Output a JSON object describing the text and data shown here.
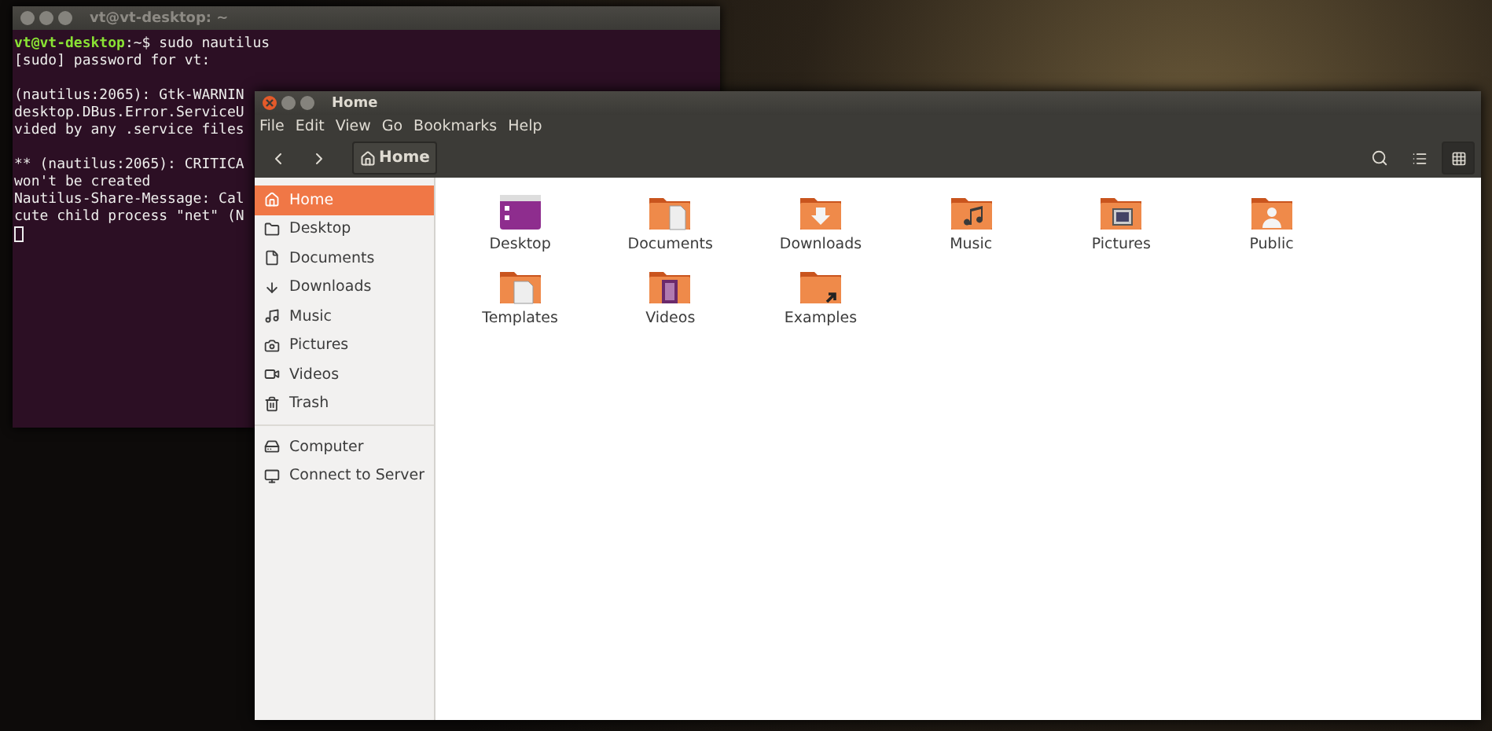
{
  "terminal": {
    "title": "vt@vt-desktop: ~",
    "prompt": {
      "user": "vt@vt-desktop",
      "rest": ":~$ sudo nautilus"
    },
    "blocks": [
      [
        "[sudo] password for vt:"
      ],
      [
        "(nautilus:2065): Gtk-WARNIN",
        "desktop.DBus.Error.ServiceU",
        "vided by any .service files"
      ],
      [
        "** (nautilus:2065): CRITICA",
        "won't be created",
        "Nautilus-Share-Message: Cal",
        "cute child process \"net\" (N"
      ]
    ]
  },
  "window": {
    "title": "Home"
  },
  "menu": [
    "File",
    "Edit",
    "View",
    "Go",
    "Bookmarks",
    "Help"
  ],
  "toolbar": {
    "path": "Home",
    "views": [
      {
        "kind": "list",
        "selected": false
      },
      {
        "kind": "grid",
        "selected": true
      }
    ]
  },
  "sidebar": {
    "sections": [
      {
        "items": [
          {
            "label": "Home",
            "kind": "home",
            "selected": true
          },
          {
            "label": "Desktop",
            "kind": "desktop",
            "selected": false
          },
          {
            "label": "Documents",
            "kind": "documents",
            "selected": false
          },
          {
            "label": "Downloads",
            "kind": "downloads",
            "selected": false
          },
          {
            "label": "Music",
            "kind": "music",
            "selected": false
          },
          {
            "label": "Pictures",
            "kind": "pictures",
            "selected": false
          },
          {
            "label": "Videos",
            "kind": "videos",
            "selected": false
          },
          {
            "label": "Trash",
            "kind": "trash",
            "selected": false
          }
        ]
      },
      {
        "items": [
          {
            "label": "Computer",
            "kind": "computer",
            "selected": false
          },
          {
            "label": "Connect to Server",
            "kind": "server",
            "selected": false
          }
        ]
      }
    ]
  },
  "files": [
    {
      "name": "Desktop",
      "kind": "desktop"
    },
    {
      "name": "Documents",
      "kind": "documents"
    },
    {
      "name": "Downloads",
      "kind": "downloads"
    },
    {
      "name": "Music",
      "kind": "music"
    },
    {
      "name": "Pictures",
      "kind": "pictures"
    },
    {
      "name": "Public",
      "kind": "public"
    },
    {
      "name": "Templates",
      "kind": "templates"
    },
    {
      "name": "Videos",
      "kind": "videos"
    },
    {
      "name": "Examples",
      "kind": "examples"
    }
  ]
}
